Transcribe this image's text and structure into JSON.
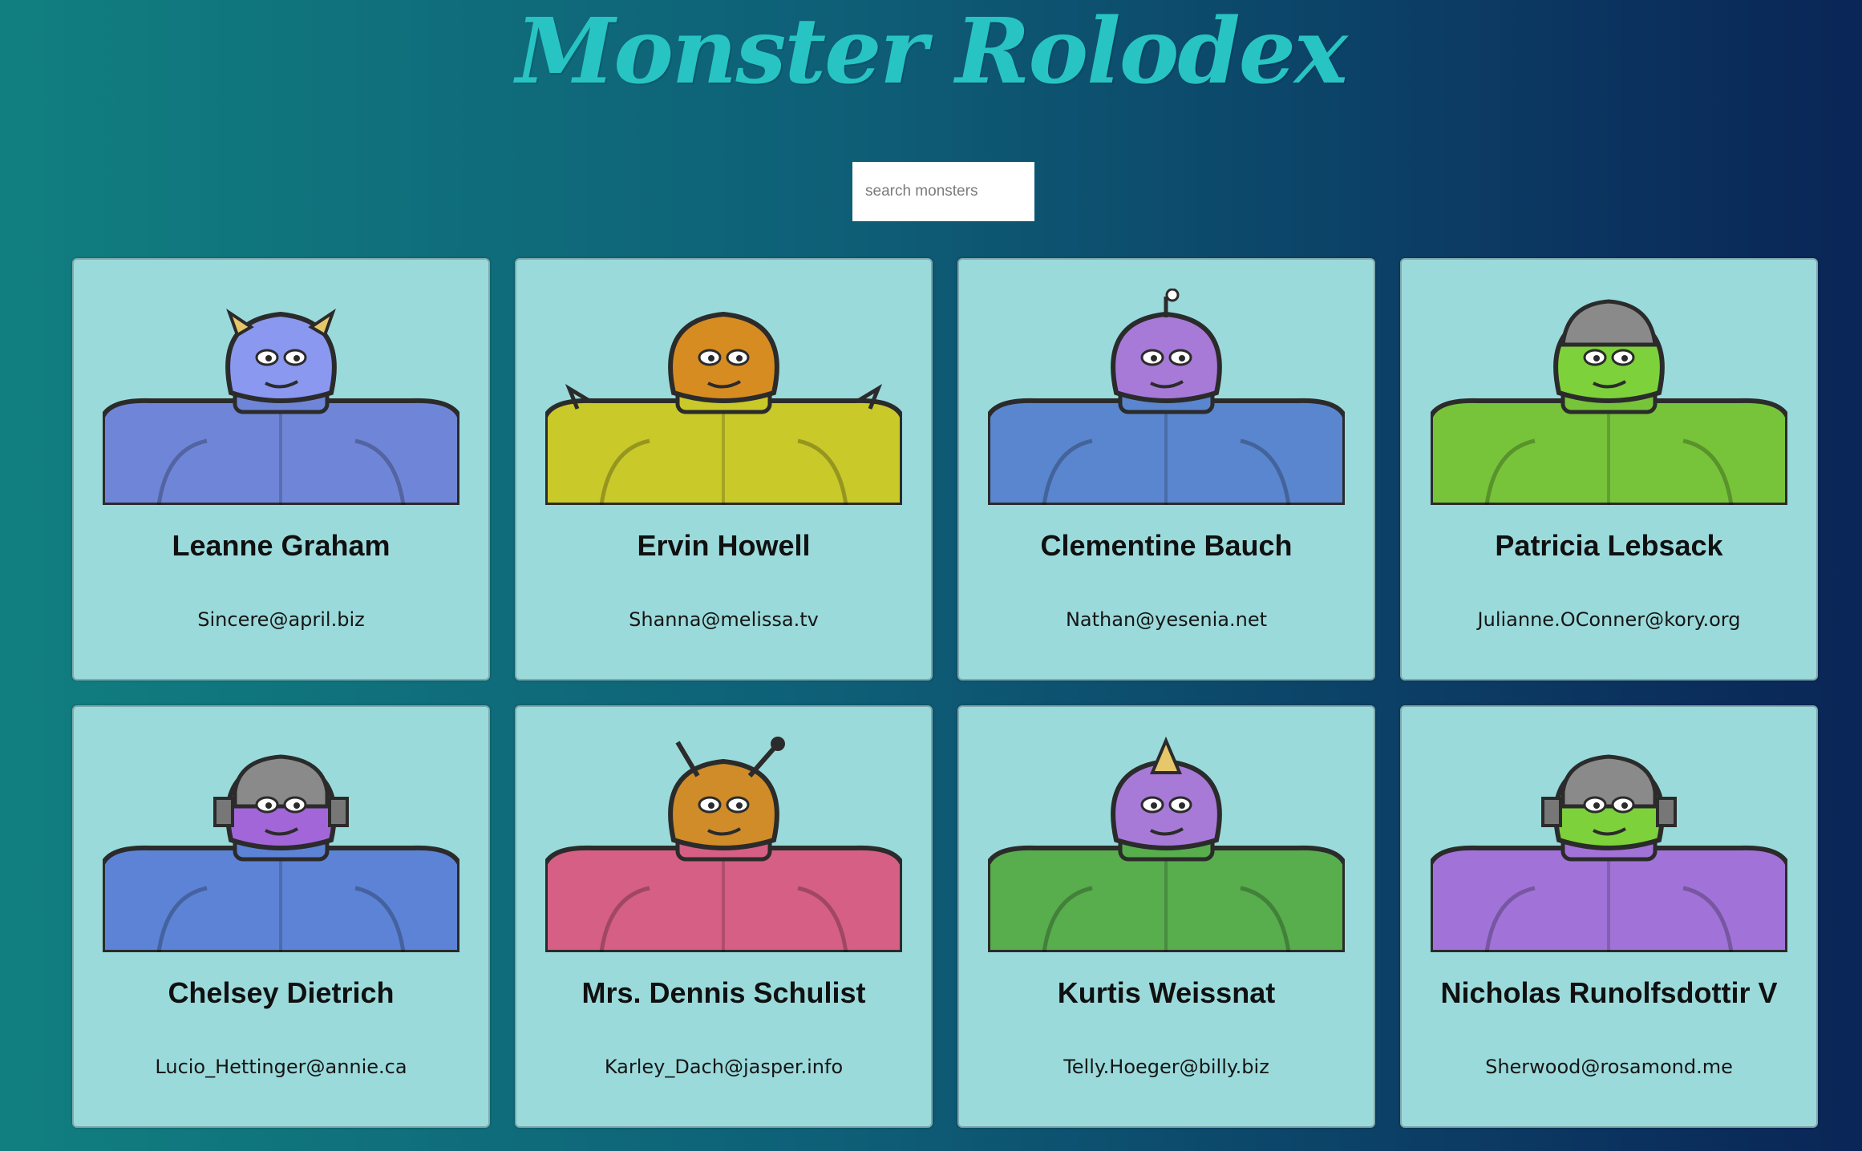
{
  "header": {
    "title": "Monster Rolodex"
  },
  "search": {
    "placeholder": "search monsters",
    "value": ""
  },
  "monsters": [
    {
      "name": "Leanne Graham",
      "email": "Sincere@april.biz",
      "head_color": "#8a98f0",
      "body_color": "#6f86d8",
      "feature": "horns-icon"
    },
    {
      "name": "Ervin Howell",
      "email": "Shanna@melissa.tv",
      "head_color": "#d78c22",
      "body_color": "#c9c92a",
      "feature": "spikes-icon"
    },
    {
      "name": "Clementine Bauch",
      "email": "Nathan@yesenia.net",
      "head_color": "#a77ad8",
      "body_color": "#5a86cf",
      "feature": "eye-stalk-icon"
    },
    {
      "name": "Patricia Lebsack",
      "email": "Julianne.OConner@kory.org",
      "head_color": "#7dd13a",
      "body_color": "#77c43a",
      "feature": "helmet-icon"
    },
    {
      "name": "Chelsey Dietrich",
      "email": "Lucio_Hettinger@annie.ca",
      "head_color": "#a266d9",
      "body_color": "#5d83d6",
      "feature": "bolts-icon"
    },
    {
      "name": "Mrs. Dennis Schulist",
      "email": "Karley_Dach@jasper.info",
      "head_color": "#cf8c28",
      "body_color": "#d65f86",
      "feature": "antennae-icon"
    },
    {
      "name": "Kurtis Weissnat",
      "email": "Telly.Hoeger@billy.biz",
      "head_color": "#a77ad8",
      "body_color": "#58ad4d",
      "feature": "horn-icon"
    },
    {
      "name": "Nicholas Runolfsdottir V",
      "email": "Sherwood@rosamond.me",
      "head_color": "#7dd13a",
      "body_color": "#a173d8",
      "feature": "bolts-icon"
    }
  ]
}
